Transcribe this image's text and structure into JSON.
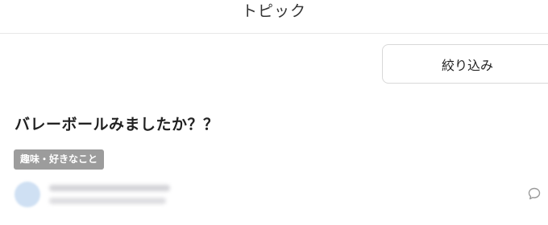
{
  "header": {
    "title": "トピック"
  },
  "toolbar": {
    "filter_label": "絞り込み"
  },
  "post": {
    "title": "バレーボールみましたか？？",
    "category": "趣味・好きなこと"
  },
  "icons": {
    "comment": "comment-icon"
  },
  "colors": {
    "tag_background": "#9c9c9c",
    "divider": "#e8e8e8",
    "avatar_placeholder": "#cfe0f3"
  }
}
